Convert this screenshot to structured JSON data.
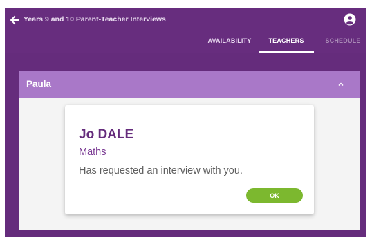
{
  "app": {
    "title": "Years 9 and 10 Parent-Teacher Interviews",
    "back_icon": "arrow-left-icon",
    "account_icon": "account-circle-icon"
  },
  "tabs": [
    {
      "label": "AVAILABILITY",
      "active": false
    },
    {
      "label": "TEACHERS",
      "active": true
    },
    {
      "label": "SCHEDULE",
      "active": false
    }
  ],
  "panel": {
    "title": "Paula",
    "toggle_icon": "chevron-up-icon"
  },
  "dialog": {
    "teacher_name": "Jo DALE",
    "subject": "Maths",
    "message": "Has requested an interview with you.",
    "ok_label": "OK"
  },
  "colors": {
    "primary": "#652c7c",
    "panel_header": "#a978c8",
    "ok_button": "#7cb82f"
  }
}
